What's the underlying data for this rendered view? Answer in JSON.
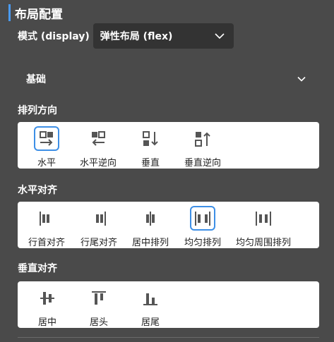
{
  "panel_title": "布局配置",
  "mode": {
    "label": "模式 (display)",
    "value": "弹性布局 (flex)"
  },
  "section": {
    "title": "基础"
  },
  "direction": {
    "label": "排列方向",
    "options": [
      {
        "label": "水平",
        "icon": "row-direction-icon",
        "selected": true
      },
      {
        "label": "水平逆向",
        "icon": "row-reverse-direction-icon",
        "selected": false
      },
      {
        "label": "垂直",
        "icon": "column-direction-icon",
        "selected": false
      },
      {
        "label": "垂直逆向",
        "icon": "column-reverse-direction-icon",
        "selected": false
      }
    ]
  },
  "justify": {
    "label": "水平对齐",
    "options": [
      {
        "label": "行首对齐",
        "icon": "justify-start-icon",
        "selected": false
      },
      {
        "label": "行尾对齐",
        "icon": "justify-end-icon",
        "selected": false
      },
      {
        "label": "居中排列",
        "icon": "justify-center-icon",
        "selected": false
      },
      {
        "label": "均匀排列",
        "icon": "justify-space-between-icon",
        "selected": true
      },
      {
        "label": "均匀周围排列",
        "icon": "justify-space-around-icon",
        "selected": false
      }
    ]
  },
  "align": {
    "label": "垂直对齐",
    "options": [
      {
        "label": "居中",
        "icon": "align-center-icon",
        "selected": false
      },
      {
        "label": "居头",
        "icon": "align-start-icon",
        "selected": false
      },
      {
        "label": "居尾",
        "icon": "align-end-icon",
        "selected": false
      }
    ]
  },
  "colors": {
    "accent": "#4a9bf5",
    "selected_border": "#3d8fe6",
    "panel_bg": "#4a4a4a",
    "select_bg": "#333333",
    "icon": "#555555"
  }
}
